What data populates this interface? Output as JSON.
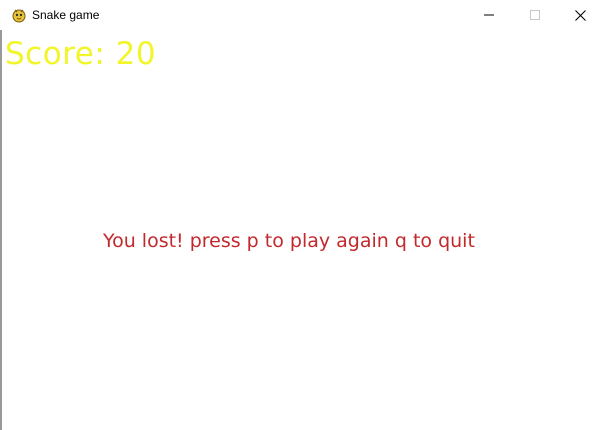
{
  "window": {
    "title": "Snake game",
    "icon": "pygame-snake-icon"
  },
  "game": {
    "score_text": "Score: 20",
    "message": "You lost! press p to play again q to quit",
    "colors": {
      "score": "#f2f529",
      "message": "#c3282c",
      "background": "#ffffff"
    }
  }
}
